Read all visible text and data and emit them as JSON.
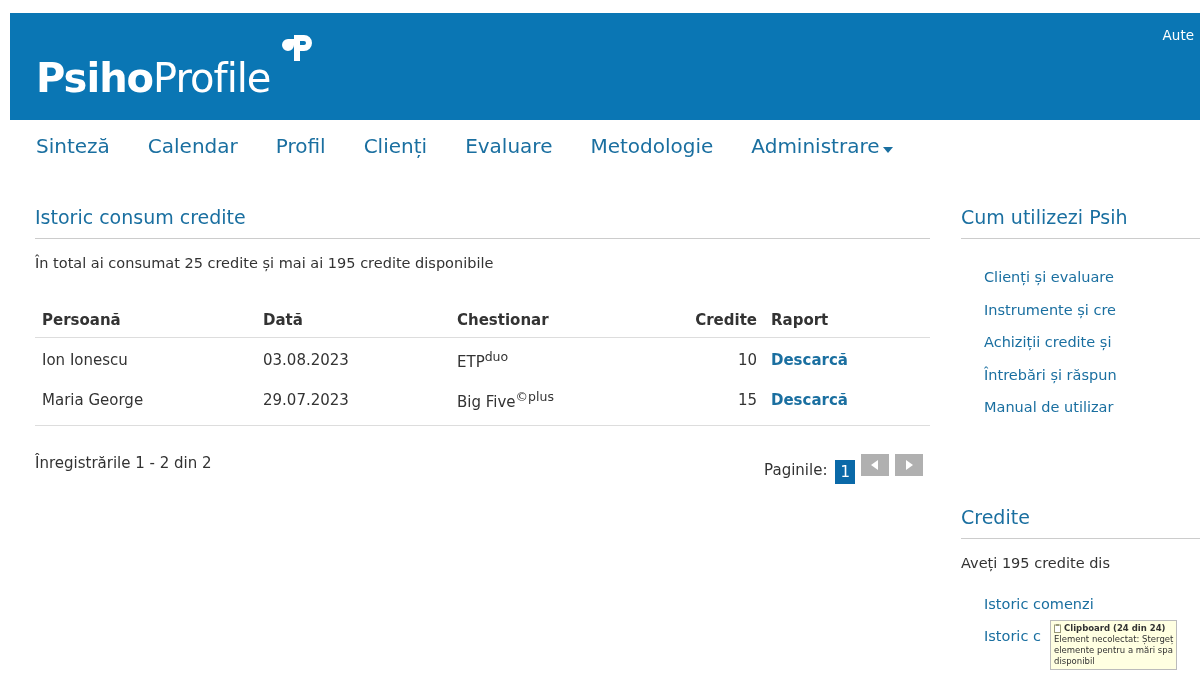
{
  "header": {
    "logo_bold": "Psiho",
    "logo_light": "Profile",
    "top_link": "Aute"
  },
  "nav": [
    {
      "label": "Sinteză",
      "dropdown": false
    },
    {
      "label": "Calendar",
      "dropdown": false
    },
    {
      "label": "Profil",
      "dropdown": false
    },
    {
      "label": "Clienți",
      "dropdown": false
    },
    {
      "label": "Evaluare",
      "dropdown": false
    },
    {
      "label": "Metodologie",
      "dropdown": false
    },
    {
      "label": "Administrare",
      "dropdown": true
    }
  ],
  "main": {
    "title": "Istoric consum credite",
    "summary": "În total ai consumat 25 credite și mai ai 195 credite disponibile",
    "table": {
      "columns": [
        "Persoană",
        "Dată",
        "Chestionar",
        "Credite",
        "Raport"
      ],
      "rows": [
        {
          "person": "Ion Ionescu",
          "date": "03.08.2023",
          "questionnaire": "ETP$^{duo}$",
          "credits": "10",
          "report": "Descarcă"
        },
        {
          "person": "Maria George",
          "date": "29.07.2023",
          "questionnaire": "Big Five$^{©plus}$",
          "credits": "15",
          "report": "Descarcă"
        }
      ]
    },
    "records": "Înregistrările 1 - 2 din 2",
    "pagination": {
      "label": "Paginile:",
      "pages": [
        {
          "label": "1",
          "selected": true
        }
      ]
    }
  },
  "sidebar": {
    "help_title": "Cum utilizezi Psih",
    "help_links": [
      "Clienți și evaluare",
      "Instrumente și cre",
      "Achiziții credite și",
      "Întrebări și răspun",
      "Manual de utilizar"
    ],
    "credits_title": "Credite",
    "credits_text": "Aveți 195 credite dis",
    "credit_links": [
      "Istoric comenzi",
      "Istoric c"
    ]
  },
  "tooltip": {
    "title": "Clipboard (24 din 24)",
    "lines": [
      "Element necolectat: Ștergeț",
      "elemente pentru a mări spa",
      "disponibil"
    ]
  }
}
